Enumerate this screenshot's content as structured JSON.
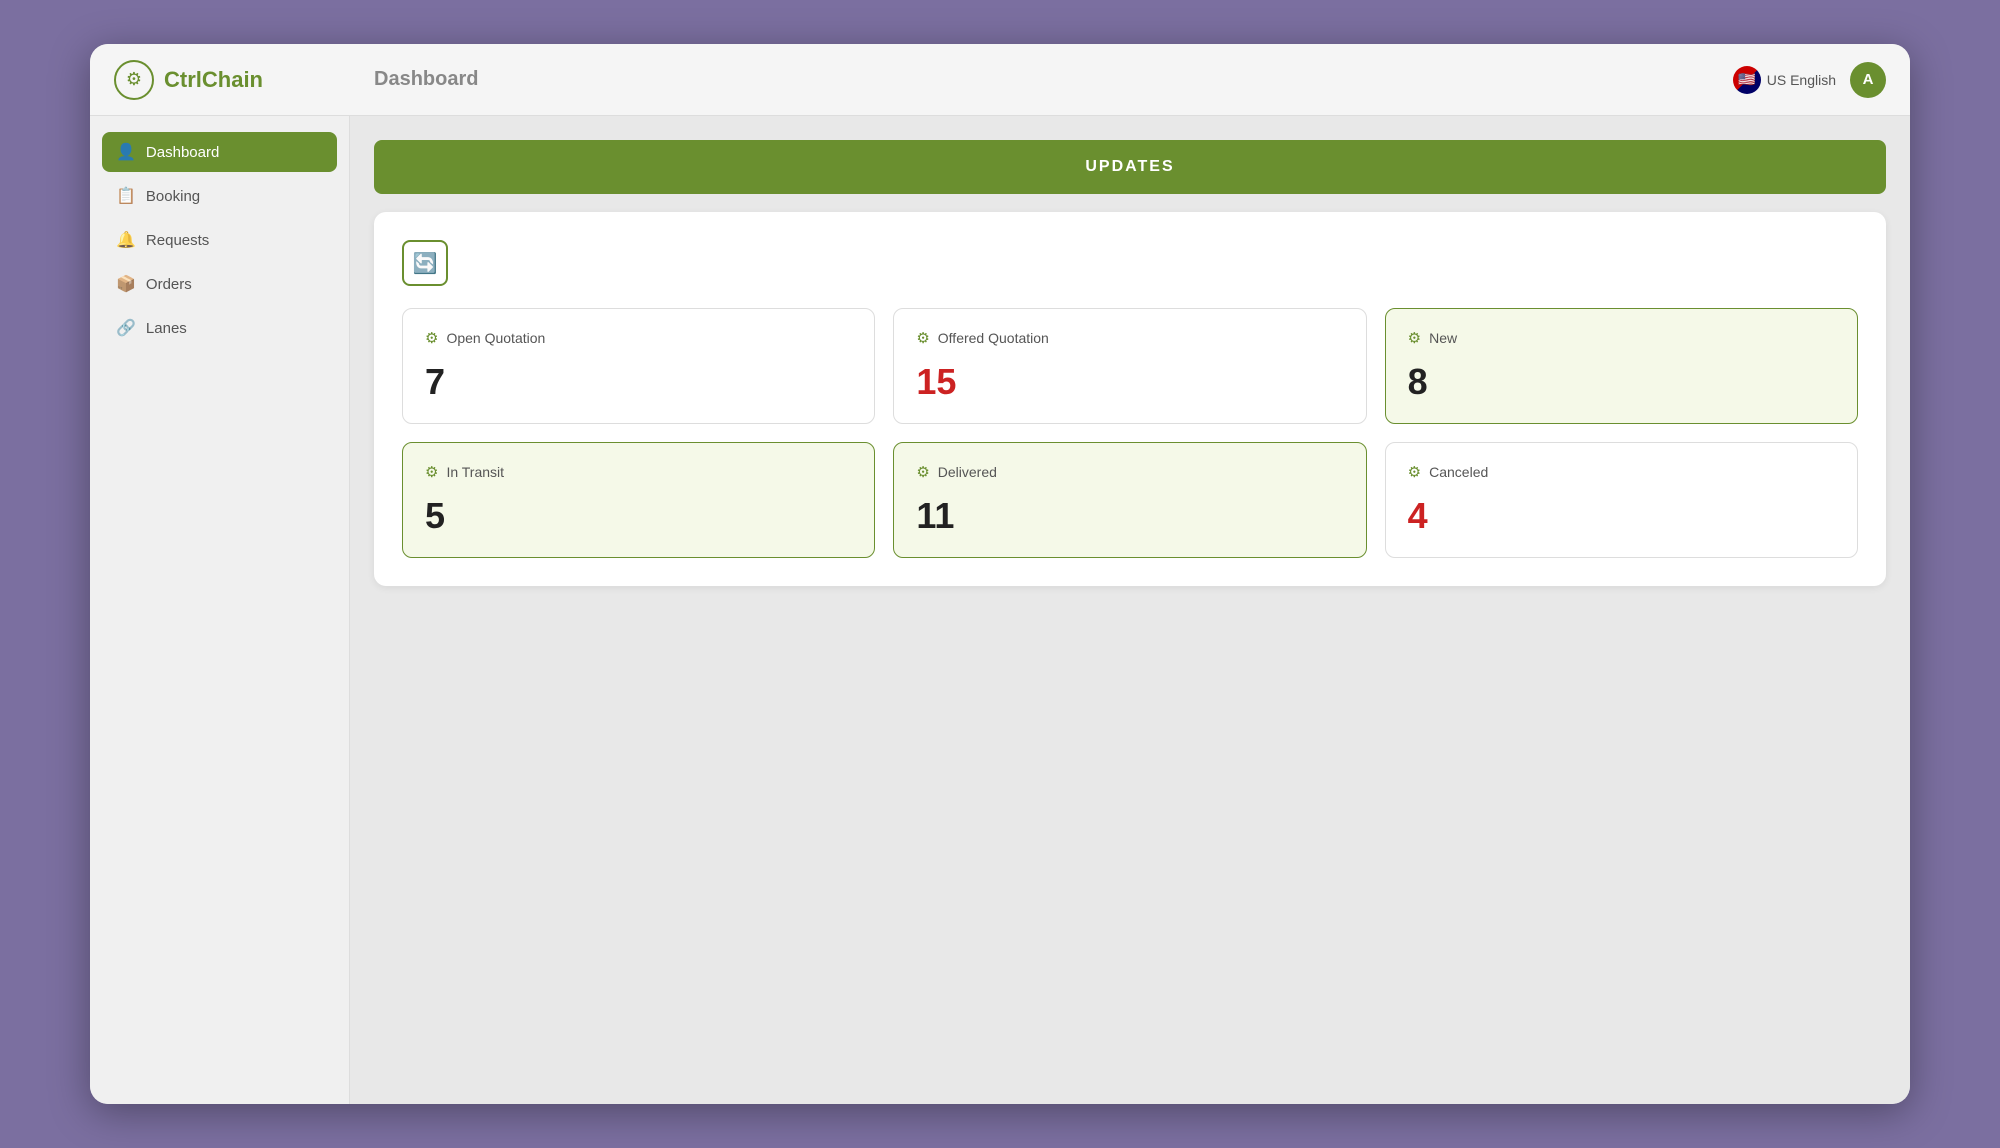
{
  "app": {
    "name": "CtrlChain",
    "logo_icon": "⚙",
    "page_title": "Dashboard"
  },
  "topbar": {
    "lang": "US English",
    "user_initials": "A"
  },
  "sidebar": {
    "items": [
      {
        "id": "dashboard",
        "label": "Dashboard",
        "icon": "👤",
        "active": true
      },
      {
        "id": "booking",
        "label": "Booking",
        "icon": "📋",
        "active": false
      },
      {
        "id": "requests",
        "label": "Requests",
        "icon": "🔔",
        "active": false
      },
      {
        "id": "orders",
        "label": "Orders",
        "icon": "📦",
        "active": false
      },
      {
        "id": "lanes",
        "label": "Lanes",
        "icon": "🔗",
        "active": false
      }
    ]
  },
  "banner": {
    "label": "UPDATES"
  },
  "refresh_button": {
    "title": "Refresh"
  },
  "stats": [
    {
      "id": "open-quotation",
      "label": "Open Quotation",
      "value": "7",
      "red": false,
      "highlighted": false
    },
    {
      "id": "offered-quotation",
      "label": "Offered Quotation",
      "value": "15",
      "red": true,
      "highlighted": false
    },
    {
      "id": "new",
      "label": "New",
      "value": "8",
      "red": false,
      "highlighted": true
    },
    {
      "id": "in-transit",
      "label": "In Transit",
      "value": "5",
      "red": false,
      "highlighted": true
    },
    {
      "id": "delivered",
      "label": "Delivered",
      "value": "11",
      "red": false,
      "highlighted": true
    },
    {
      "id": "canceled",
      "label": "Canceled",
      "value": "4",
      "red": true,
      "highlighted": false
    }
  ]
}
